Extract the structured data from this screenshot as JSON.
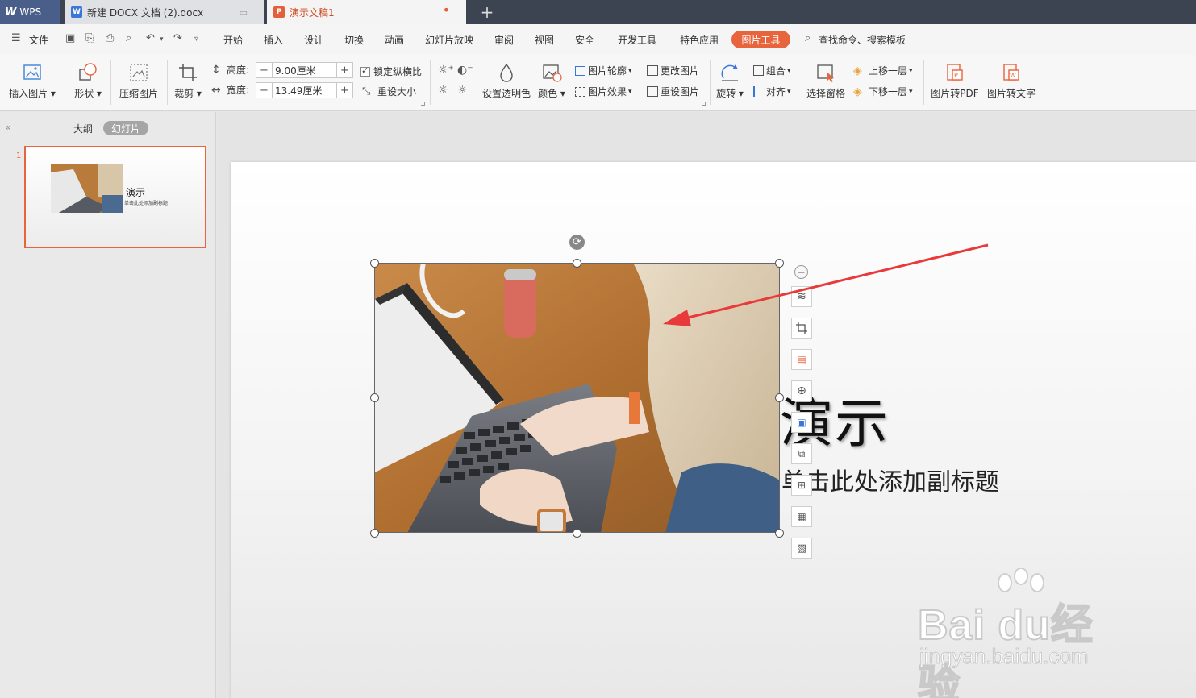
{
  "tabs": {
    "wps_label": "WPS",
    "doc_label": "新建 DOCX 文档 (2).docx",
    "ppt_label": "演示文稿1",
    "new_tab_symbol": "+"
  },
  "menu": {
    "file": "文件",
    "items": [
      "开始",
      "插入",
      "设计",
      "切换",
      "动画",
      "幻灯片放映",
      "审阅",
      "视图",
      "安全",
      "开发工具",
      "特色应用"
    ],
    "active": "图片工具",
    "search": "查找命令、搜索模板"
  },
  "ribbon": {
    "insert_picture": "插入图片",
    "shape": "形状",
    "compress": "压缩图片",
    "crop": "裁剪",
    "height_label": "高度:",
    "height_value": "9.00厘米",
    "width_label": "宽度:",
    "width_value": "13.49厘米",
    "lock_ratio": "锁定纵横比",
    "reset_size": "重设大小",
    "set_transparent": "设置透明色",
    "color": "颜色",
    "outline": "图片轮廓",
    "change_picture": "更改图片",
    "effects": "图片效果",
    "reset_picture": "重设图片",
    "rotate": "旋转",
    "group": "组合",
    "align": "对齐",
    "selection_pane": "选择窗格",
    "bring_forward": "上移一层",
    "send_backward": "下移一层",
    "to_pdf": "图片转PDF",
    "to_text": "图片转文字"
  },
  "left_pane": {
    "outline_tab": "大纲",
    "slides_tab": "幻灯片",
    "slide_number": "1",
    "thumb_title": "演示",
    "thumb_sub": "单击此处添加副标题"
  },
  "slide": {
    "title_visible": "演示",
    "subtitle_visible": "单击此处添加副标题"
  },
  "watermark": {
    "brand": "Bai du经验",
    "url": "jingyan.baidu.com"
  },
  "colors": {
    "accent": "#e8643c",
    "titlebar": "#3c4351",
    "arrow": "#e83a3a"
  }
}
